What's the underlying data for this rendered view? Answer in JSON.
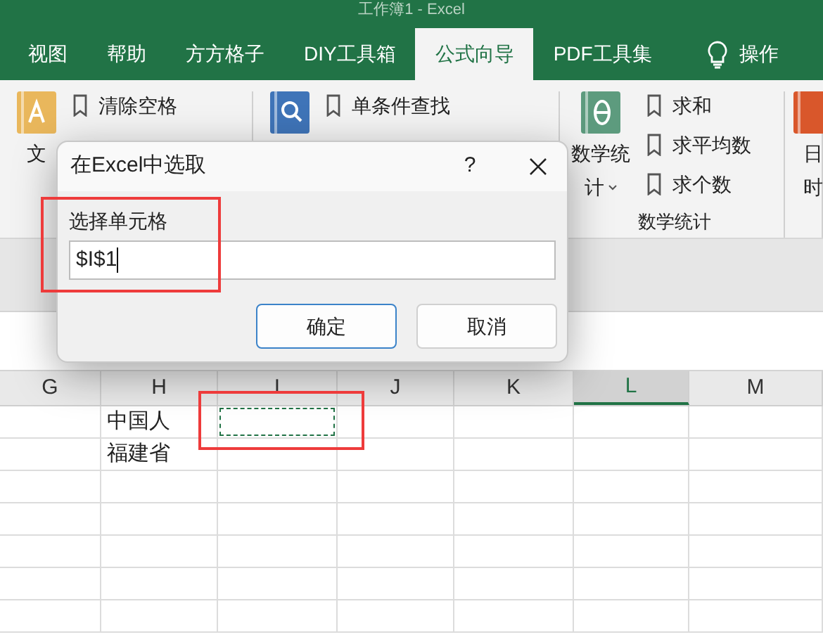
{
  "window": {
    "title": "工作簿1 - Excel"
  },
  "tabs": [
    {
      "label": "视图",
      "selected": false
    },
    {
      "label": "帮助",
      "selected": false
    },
    {
      "label": "方方格子",
      "selected": false
    },
    {
      "label": "DIY工具箱",
      "selected": false
    },
    {
      "label": "公式向导",
      "selected": true
    },
    {
      "label": "PDF工具集",
      "selected": false
    }
  ],
  "tell_me": {
    "label": "操作"
  },
  "ribbon": {
    "groups": [
      {
        "kind": "text",
        "label_lines": [
          "文"
        ],
        "items": [
          "清除空格"
        ]
      },
      {
        "kind": "search",
        "items": [
          "单条件查找"
        ]
      },
      {
        "kind": "theta",
        "label_lines": [
          "数学统",
          "计"
        ],
        "dropdown": true,
        "items": [
          "求和",
          "求平均数",
          "求个数"
        ],
        "title": "数学统计"
      },
      {
        "kind": "date",
        "label_lines": [
          "日",
          "时"
        ]
      }
    ]
  },
  "sheet": {
    "columns": [
      {
        "label": "G",
        "selected": false
      },
      {
        "label": "H",
        "selected": false
      },
      {
        "label": "I",
        "selected": false
      },
      {
        "label": "J",
        "selected": false
      },
      {
        "label": "K",
        "selected": false
      },
      {
        "label": "L",
        "selected": true
      },
      {
        "label": "M",
        "selected": false
      }
    ],
    "rows": [
      {
        "cells": [
          {
            "marquee": false,
            "highlighted": false
          },
          {
            "text": "中国人",
            "marquee": false,
            "highlighted": false
          },
          {
            "marquee": true,
            "highlighted": true
          },
          {
            "marquee": false,
            "highlighted": false
          },
          {
            "marquee": false,
            "highlighted": false
          },
          {
            "marquee": false,
            "highlighted": false
          },
          {
            "marquee": false,
            "highlighted": false
          }
        ]
      },
      {
        "cells": [
          {
            "marquee": false,
            "highlighted": false
          },
          {
            "text": "福建省",
            "marquee": false,
            "highlighted": false
          },
          {
            "marquee": false,
            "highlighted": false
          },
          {
            "marquee": false,
            "highlighted": false
          },
          {
            "marquee": false,
            "highlighted": false
          },
          {
            "marquee": false,
            "highlighted": false
          },
          {
            "marquee": false,
            "highlighted": false
          }
        ]
      }
    ]
  },
  "dialog": {
    "title": "在Excel中选取",
    "help": "?",
    "label": "选择单元格",
    "value": "$I$1",
    "field_highlighted": true,
    "buttons": [
      {
        "label": "确定",
        "default": true
      },
      {
        "label": "取消",
        "default": false
      }
    ]
  }
}
